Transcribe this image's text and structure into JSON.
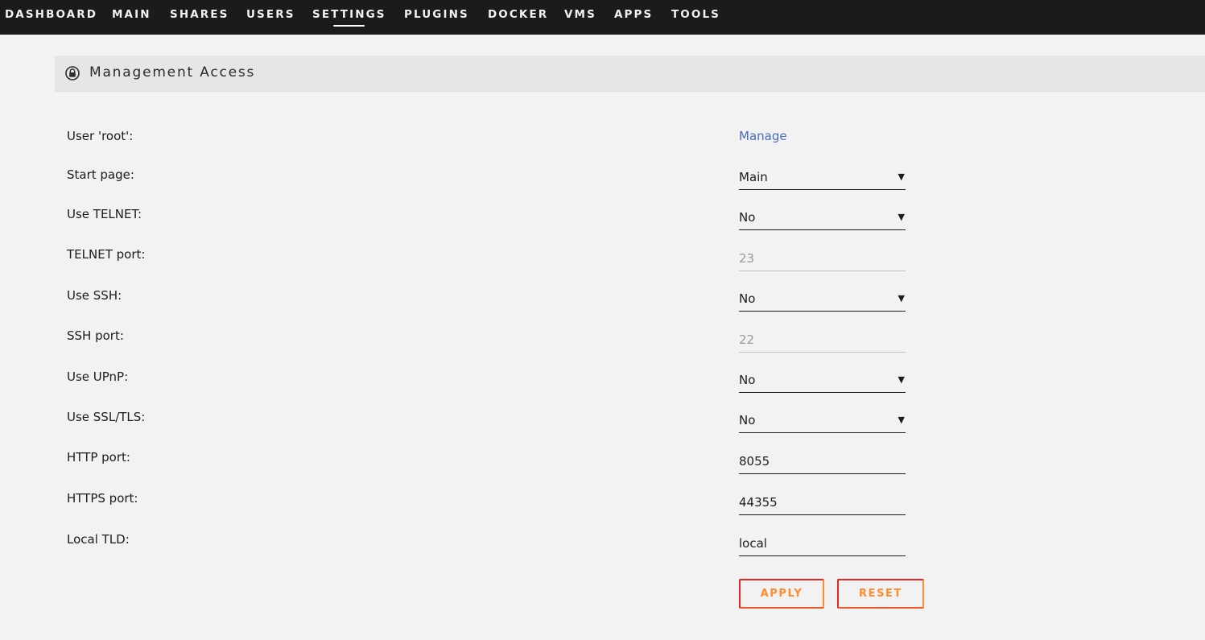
{
  "nav": {
    "items": [
      {
        "label": "DASHBOARD"
      },
      {
        "label": "MAIN"
      },
      {
        "label": "SHARES"
      },
      {
        "label": "USERS"
      },
      {
        "label": "SETTINGS",
        "active": true
      },
      {
        "label": "PLUGINS"
      },
      {
        "label": "DOCKER"
      },
      {
        "label": "VMS"
      },
      {
        "label": "APPS"
      },
      {
        "label": "TOOLS"
      }
    ]
  },
  "section": {
    "icon": "lock-icon",
    "title": "Management Access"
  },
  "form": {
    "user_root": {
      "label": "User 'root':",
      "link": "Manage"
    },
    "start_page": {
      "label": "Start page:",
      "value": "Main"
    },
    "use_telnet": {
      "label": "Use TELNET:",
      "value": "No"
    },
    "telnet_port": {
      "label": "TELNET port:",
      "value": "23"
    },
    "use_ssh": {
      "label": "Use SSH:",
      "value": "No"
    },
    "ssh_port": {
      "label": "SSH port:",
      "value": "22"
    },
    "use_upnp": {
      "label": "Use UPnP:",
      "value": "No"
    },
    "use_ssl": {
      "label": "Use SSL/TLS:",
      "value": "No"
    },
    "http_port": {
      "label": "HTTP port:",
      "value": "8055"
    },
    "https_port": {
      "label": "HTTPS port:",
      "value": "44355"
    },
    "local_tld": {
      "label": "Local TLD:",
      "value": "local"
    }
  },
  "buttons": {
    "apply": "APPLY",
    "reset": "RESET"
  },
  "colors": {
    "nav_bg": "#1c1b1b",
    "page_bg": "#f2f2f2",
    "link": "#486dba",
    "button_text": "#ff8c2f",
    "button_border": "#e22828"
  }
}
